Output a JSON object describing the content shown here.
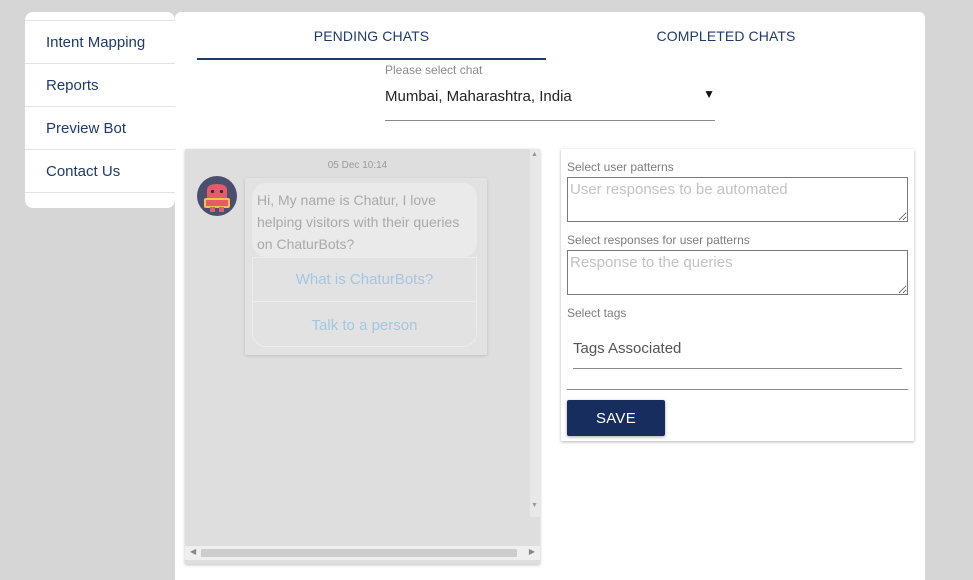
{
  "sidebar": {
    "items": [
      {
        "label": "Intent Mapping"
      },
      {
        "label": "Reports"
      },
      {
        "label": "Preview Bot"
      },
      {
        "label": "Contact Us"
      }
    ]
  },
  "tabs": [
    {
      "label": "PENDING CHATS",
      "active": true
    },
    {
      "label": "COMPLETED CHATS",
      "active": false
    }
  ],
  "chat_select": {
    "label": "Please select chat",
    "value": "Mumbai, Maharashtra, India",
    "caret": "▼"
  },
  "chat": {
    "date": "05 Dec 10:14",
    "avatar_icon": "robot-avatar-icon",
    "message": "Hi, My name is Chatur, I love helping visitors with their queries on ChaturBots?",
    "options": [
      {
        "label": "What is ChaturBots?"
      },
      {
        "label": "Talk to a person"
      }
    ]
  },
  "form": {
    "user_patterns_label": "Select user patterns",
    "user_patterns_placeholder": "User responses to be automated",
    "responses_label": "Select responses for user patterns",
    "responses_placeholder": "Response to the queries",
    "tags_label": "Select tags",
    "tags_placeholder": "Tags Associated",
    "save_label": "SAVE"
  },
  "colors": {
    "brand_navy": "#172d5e",
    "link_navy": "#1f3a6d",
    "page_bg": "#d6d6d6",
    "avatar_bg": "#4b4f6e",
    "avatar_robot": "#e85a6b"
  }
}
